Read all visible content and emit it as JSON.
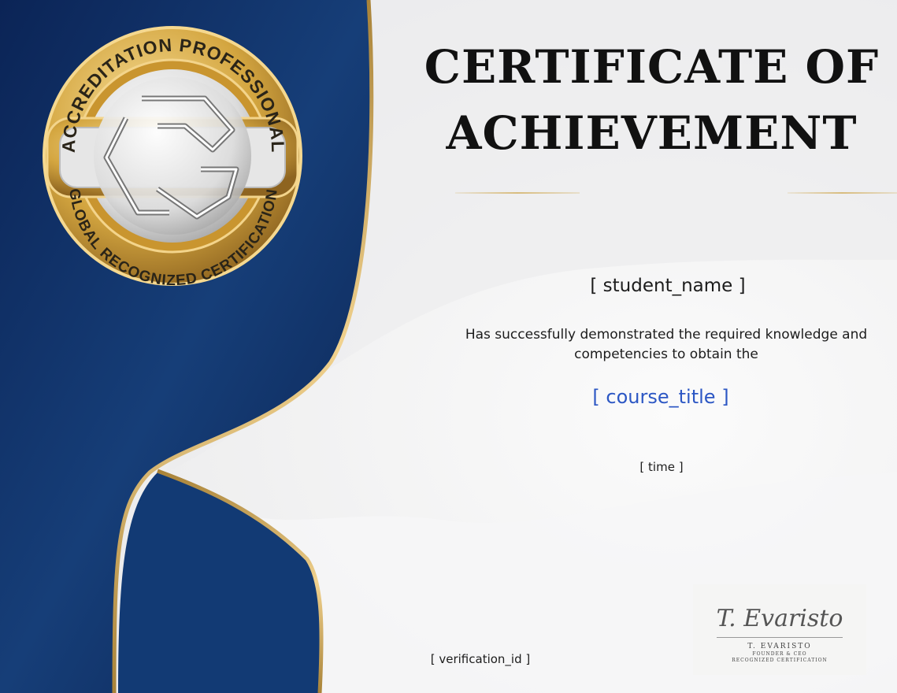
{
  "certificate": {
    "title_line1": "CERTIFICATE OF",
    "title_line2": "ACHIEVEMENT",
    "student_name": "[ student_name ]",
    "description_line1": "Has successfully demonstrated the required knowledge and",
    "description_line2": "competencies to obtain the",
    "course_title": "[ course_title ]",
    "time": "[ time ]",
    "verification_id": "[ verification_id ]"
  },
  "badge": {
    "top_text": "ACCREDITATION PROFESSIONAL",
    "bottom_text": "GLOBAL RECOGNIZED CERTIFICATION"
  },
  "signature": {
    "script": "T. Evaristo",
    "name": "T. EVARISTO",
    "role": "FOUNDER & CEO",
    "org": "RECOGNIZED CERTIFICATION"
  },
  "colors": {
    "navy": "#0e2a5c",
    "gold": "#c9a255",
    "accent_blue": "#2c57c4"
  }
}
